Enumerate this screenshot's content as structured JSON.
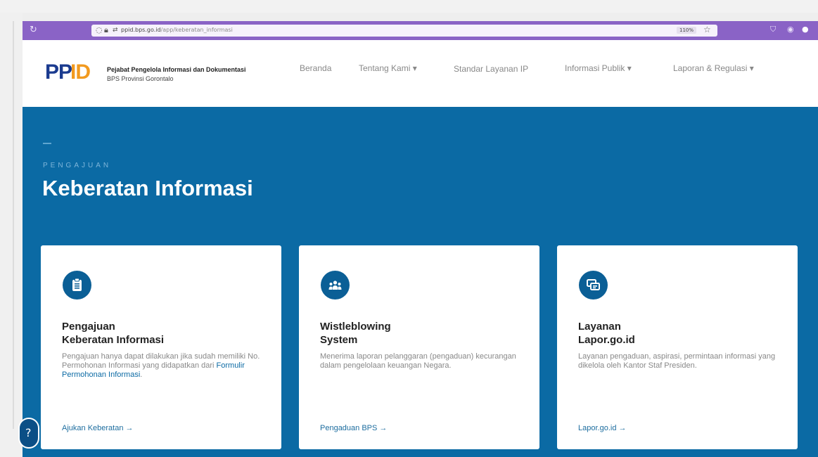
{
  "browser": {
    "url_host": "ppid.bps.go.id",
    "url_rest": "/app/keberatan_informasi",
    "zoom": "110%"
  },
  "site": {
    "logo_text": "PPID",
    "brand_title": "Pejabat Pengelola Informasi dan Dokumentasi",
    "brand_subtitle": "BPS Provinsi Gorontalo"
  },
  "nav": [
    {
      "label": "Beranda"
    },
    {
      "label": "Tentang Kami ▾"
    },
    {
      "label": "Standar Layanan IP"
    },
    {
      "label": "Informasi Publik ▾"
    },
    {
      "label": "Laporan & Regulasi ▾"
    }
  ],
  "hero": {
    "eyebrow": "PENGAJUAN",
    "title": "Keberatan Informasi"
  },
  "cards": [
    {
      "icon": "clipboard-icon",
      "title_line1": "Pengajuan",
      "title_line2": "Keberatan Informasi",
      "desc_text": "Pengajuan hanya dapat dilakukan jika sudah memiliki No. Permohonan Informasi yang didapatkan dari ",
      "desc_link": "Formulir Permohonan Informasi",
      "desc_tail": ".",
      "cta": "Ajukan Keberatan →"
    },
    {
      "icon": "people-icon",
      "title_line1": "Wistleblowing",
      "title_line2": "System",
      "desc_text": "Menerima laporan pelanggaran (pengaduan) kecurangan dalam pengelolaan keuangan Negara.",
      "cta": "Pengaduan BPS →"
    },
    {
      "icon": "chat-icon",
      "title_line1": "Layanan",
      "title_line2": "Lapor.go.id",
      "desc_text": "Layanan pengaduan, aspirasi, permintaan informasi yang dikelola oleh Kantor Staf Presiden.",
      "cta": "Lapor.go.id →"
    }
  ],
  "colors": {
    "hero_blue": "#0b6aa4",
    "icon_circle": "#0b5f96",
    "browser_purple": "#8a63c6",
    "logo_blue": "#1b3b8f",
    "logo_orange": "#f29a1f"
  }
}
